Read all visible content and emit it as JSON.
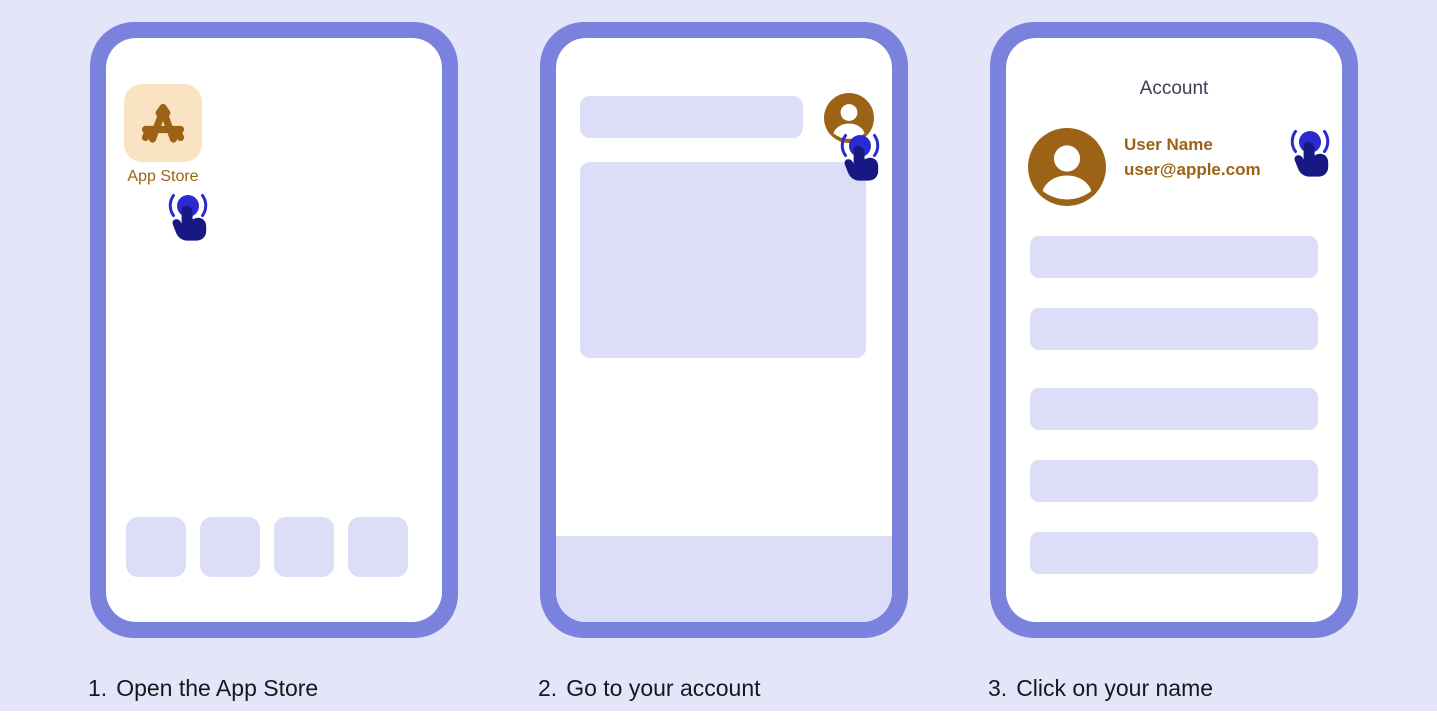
{
  "theme": {
    "page_background": "#e4e5f8",
    "bezel": "#7b82de",
    "screen": "#ffffff",
    "placeholder": "#dcdef7",
    "brand_brown": "#9c6316",
    "app_icon_bg": "#f9e3c2",
    "cursor_circle": "#2a2ad0",
    "cursor_hand": "#181883",
    "title_text": "#3a3f52",
    "caption_text": "#16181d"
  },
  "steps": [
    {
      "number": "1.",
      "caption": "Open the App Store",
      "screen": {
        "kind": "home-screen",
        "app": {
          "name": "App Store",
          "icon": "app-store-icon"
        },
        "dock_slots": [
          "",
          "",
          "",
          ""
        ],
        "cursor": "tap-gesture-icon"
      }
    },
    {
      "number": "2.",
      "caption": "Go to your account",
      "screen": {
        "kind": "app-screen",
        "avatar": "account-avatar-icon",
        "placeholders": [
          "top-bar",
          "content-card",
          "bottom-bar"
        ],
        "cursor": "tap-gesture-icon"
      }
    },
    {
      "number": "3.",
      "caption": "Click on your name",
      "screen": {
        "kind": "account-screen",
        "title": "Account",
        "avatar": "account-avatar-icon",
        "user_name": "User Name",
        "user_email": "user@apple.com",
        "rows": [
          "",
          "",
          "",
          "",
          ""
        ],
        "cursor": "tap-gesture-icon"
      }
    }
  ]
}
